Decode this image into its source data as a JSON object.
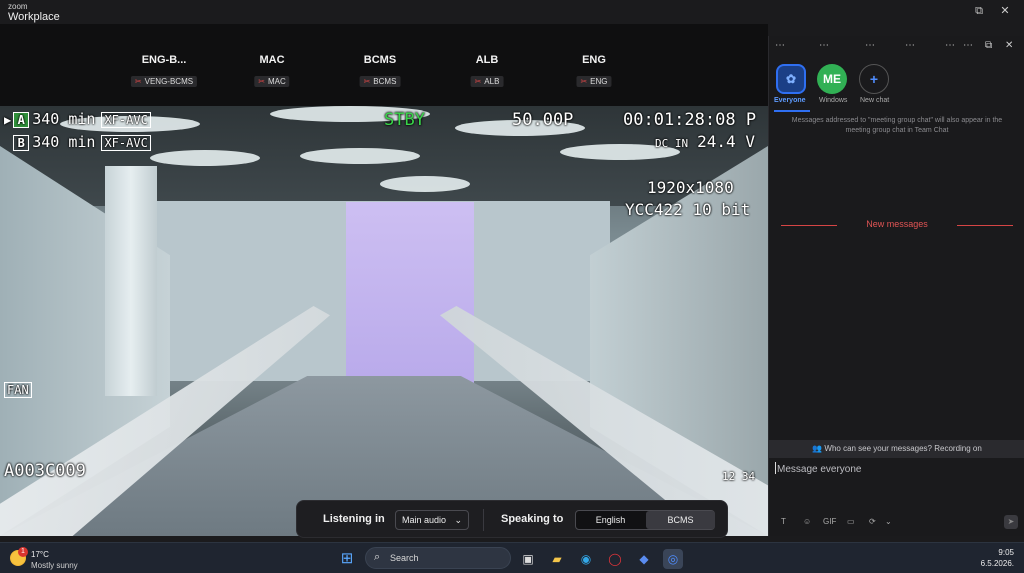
{
  "app": {
    "brand_line1": "zoom",
    "brand_line2": "Workplace"
  },
  "window_controls": {
    "restore": "⧉",
    "close": "✕"
  },
  "participants": [
    {
      "name": "ENG-B...",
      "label": "VENG-BCMS"
    },
    {
      "name": "MAC",
      "label": "MAC"
    },
    {
      "name": "BCMS",
      "label": "BCMS"
    },
    {
      "name": "ALB",
      "label": "ALB"
    },
    {
      "name": "ENG",
      "label": "ENG"
    }
  ],
  "camera_overlay": {
    "slot_a": "A",
    "slot_a_time": "340 min",
    "slot_a_codec": "XF-AVC",
    "slot_b": "B",
    "slot_b_time": "340 min",
    "slot_b_codec": "XF-AVC",
    "status": "STBY",
    "framerate": "50.00P",
    "timecode": "00:01:28:08 P",
    "dc_in_label": "DC IN",
    "dc_in_value": "24.4 V",
    "resolution": "1920x1080",
    "color": "YCC422 10 bit",
    "fan": "FAN",
    "clip": "A003C009",
    "audio_ch": "12  34"
  },
  "listen_bar": {
    "listening_in_label": "Listening in",
    "listening_value": "Main audio",
    "speaking_to_label": "Speaking to",
    "options": [
      "English",
      "BCMS"
    ],
    "selected": "BCMS"
  },
  "chat": {
    "avatars": [
      {
        "label": "Everyone",
        "initials": ""
      },
      {
        "label": "Windows",
        "initials": "ME"
      },
      {
        "label": "New chat",
        "initials": "+"
      }
    ],
    "note": "Messages addressed to \"meeting group chat\" will also appear in the meeting group chat in Team Chat",
    "new_messages": "New messages",
    "who_can_see": "Who can see your messages? Recording on",
    "input_placeholder": "Message everyone",
    "tools": [
      "T",
      "☺",
      "GIF",
      "▭",
      "⟳",
      "⌄"
    ]
  },
  "taskbar": {
    "temperature": "17°C",
    "condition": "Mostly sunny",
    "weather_badge": "1",
    "search_label": "Search",
    "time": "9:05",
    "date": "6.5.2026."
  },
  "colors": {
    "accent_blue": "#2f6ff2",
    "me_green": "#31b054",
    "alert_red": "#e05454"
  }
}
